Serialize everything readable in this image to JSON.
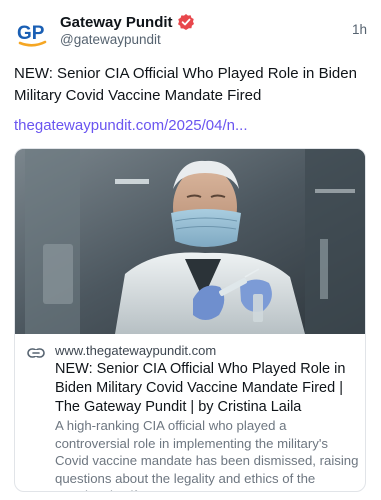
{
  "post": {
    "author": {
      "display_name": "Gateway Pundit",
      "handle": "@gatewaypundit",
      "verified": true,
      "avatar_text": "GP",
      "avatar_color": "#1a5fb4",
      "avatar_accent": "#f5a623"
    },
    "timestamp": "1h",
    "text": "NEW: Senior CIA Official Who Played Role in Biden Military Covid Vaccine Mandate Fired",
    "link_text": "thegatewaypundit.com/2025/04/n...",
    "colors": {
      "link": "#6a55f0",
      "verified_badge": "#e8474c"
    },
    "card": {
      "image_description_icon": "masked-man-with-syringe-image",
      "domain": "www.thegatewaypundit.com",
      "title": "NEW: Senior CIA Official Who Played Role in Biden Military Covid Vaccine Mandate Fired | The Gateway Pundit | by Cristina Laila",
      "description": "A high-ranking CIA official who played a controversial role in implementing the military's Covid vaccine mandate has been dismissed, raising questions about the legality and ethics of the mandate itself."
    }
  }
}
